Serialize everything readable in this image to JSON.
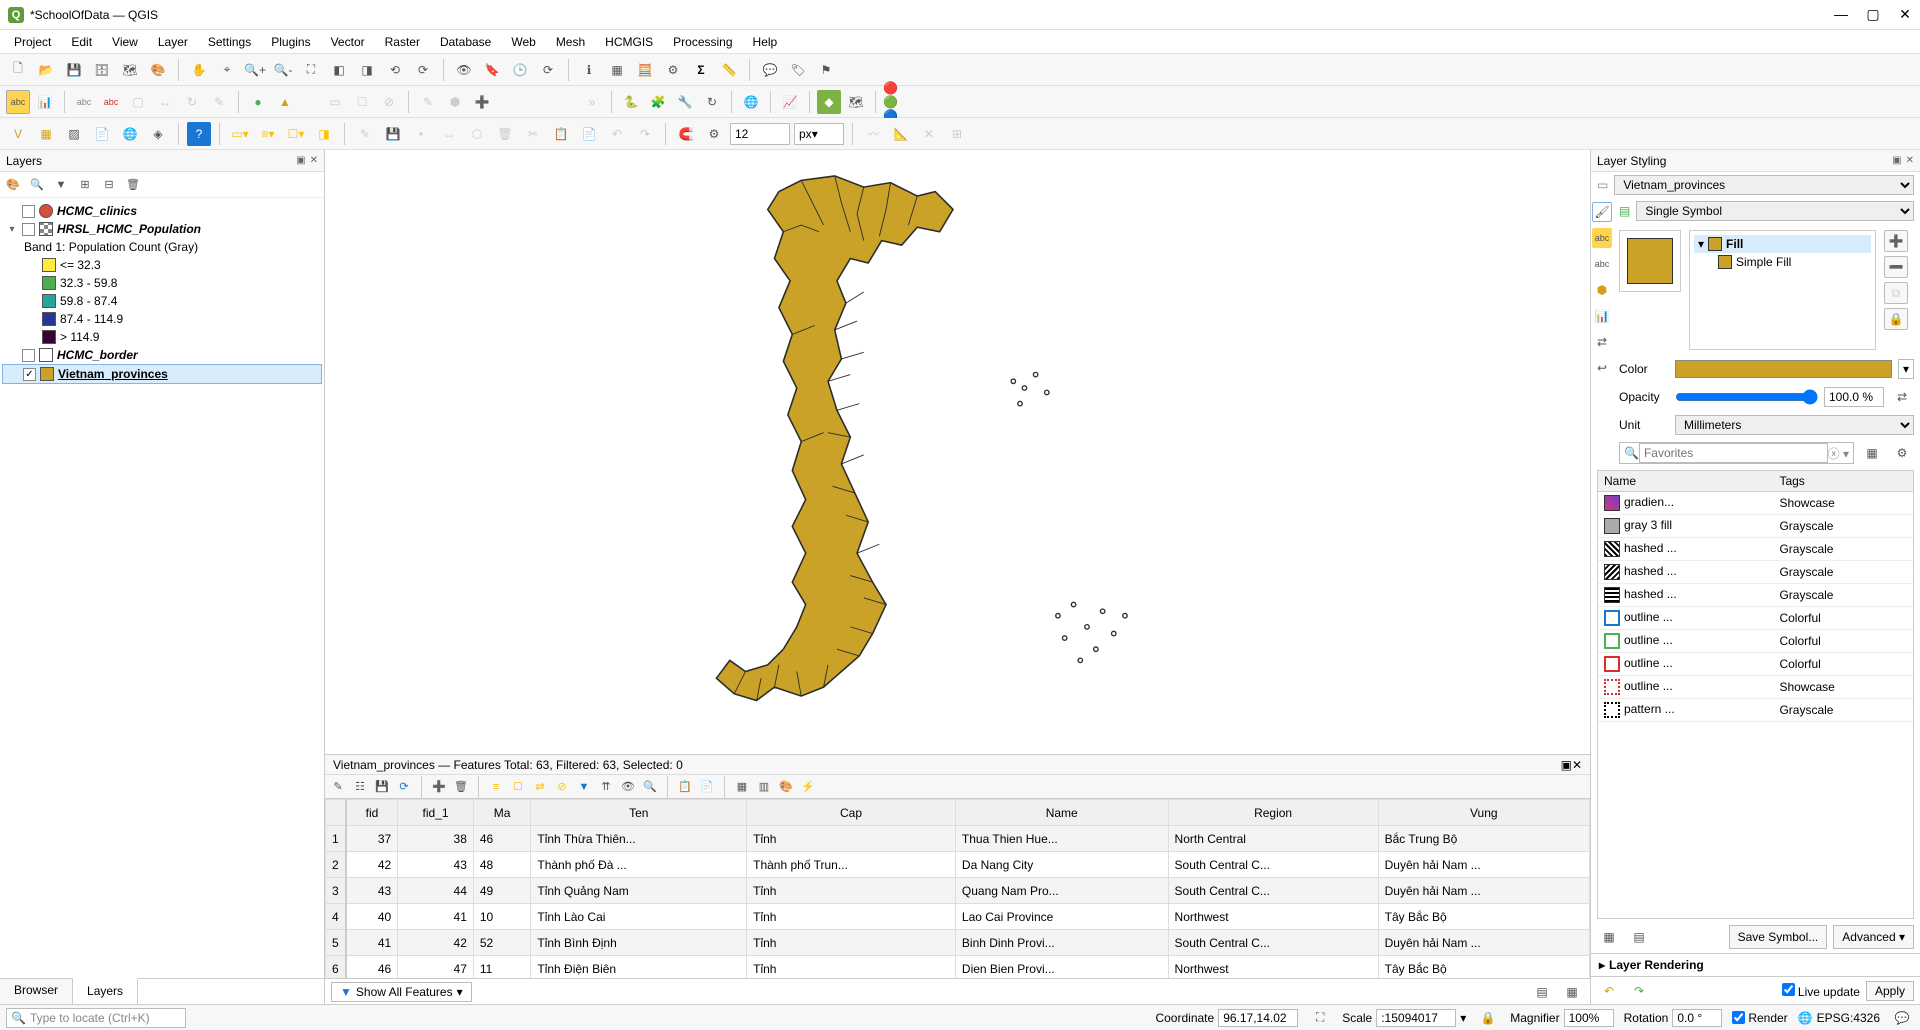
{
  "title": "*SchoolOfData — QGIS",
  "menu": [
    "Project",
    "Edit",
    "View",
    "Layer",
    "Settings",
    "Plugins",
    "Vector",
    "Raster",
    "Database",
    "Web",
    "Mesh",
    "HCMGIS",
    "Processing",
    "Help"
  ],
  "layers_panel": {
    "title": "Layers",
    "items": [
      {
        "name": "HCMC_clinics",
        "checked": false,
        "swatch": "#d94d3a",
        "shape": "circle",
        "bold": true
      },
      {
        "name": "HRSL_HCMC_Population",
        "checked": false,
        "swatch": "checker",
        "bold": true,
        "expanded": true
      },
      {
        "name": "Band 1: Population Count (Gray)",
        "indent": 1
      },
      {
        "name": "<= 32.3",
        "indent": 2,
        "swatch": "#ffeb3b"
      },
      {
        "name": "32.3 - 59.8",
        "indent": 2,
        "swatch": "#4caf50"
      },
      {
        "name": "59.8 - 87.4",
        "indent": 2,
        "swatch": "#26a69a"
      },
      {
        "name": "87.4 - 114.9",
        "indent": 2,
        "swatch": "#283593"
      },
      {
        "name": "> 114.9",
        "indent": 2,
        "swatch": "#3a0232"
      },
      {
        "name": "HCMC_border",
        "checked": false,
        "swatch": "none",
        "bold": true
      },
      {
        "name": "Vietnam_provinces",
        "checked": true,
        "swatch": "#C9A227",
        "selected": true,
        "underline": true
      }
    ],
    "tabs": [
      "Browser",
      "Layers"
    ],
    "active_tab": "Layers"
  },
  "attribute_table": {
    "header": "Vietnam_provinces — Features Total: 63, Filtered: 63, Selected: 0",
    "columns": [
      "fid",
      "fid_1",
      "Ma",
      "Ten",
      "Cap",
      "Name",
      "Region",
      "Vung"
    ],
    "rows": [
      [
        "37",
        "38",
        "46",
        "Tỉnh Thừa Thiên...",
        "Tỉnh",
        "Thua Thien Hue...",
        "North Central",
        "Bắc Trung Bộ"
      ],
      [
        "42",
        "43",
        "48",
        "Thành phố Đà ...",
        "Thành phố Trun...",
        "Da Nang City",
        "South Central C...",
        "Duyên hải Nam ..."
      ],
      [
        "43",
        "44",
        "49",
        "Tỉnh Quảng Nam",
        "Tỉnh",
        "Quang Nam Pro...",
        "South Central C...",
        "Duyên hải Nam ..."
      ],
      [
        "40",
        "41",
        "10",
        "Tỉnh Lào Cai",
        "Tỉnh",
        "Lao Cai Province",
        "Northwest",
        "Tây Bắc Bộ"
      ],
      [
        "41",
        "42",
        "52",
        "Tỉnh Bình Định",
        "Tỉnh",
        "Binh Dinh Provi...",
        "South Central C...",
        "Duyên hải Nam ..."
      ],
      [
        "46",
        "47",
        "11",
        "Tỉnh Điện Biên",
        "Tỉnh",
        "Dien Bien Provi...",
        "Northwest",
        "Tây Bắc Bộ"
      ]
    ],
    "filter_text": "Show All Features"
  },
  "layer_styling": {
    "title": "Layer Styling",
    "layer": "Vietnam_provinces",
    "symbol_mode": "Single Symbol",
    "fill_label": "Fill",
    "simple_fill_label": "Simple Fill",
    "color_label": "Color",
    "color_value": "#C9A227",
    "opacity_label": "Opacity",
    "opacity_value": "100.0 %",
    "unit_label": "Unit",
    "unit_value": "Millimeters",
    "search_placeholder": "Favorites",
    "fav_columns": [
      "Name",
      "Tags"
    ],
    "favorites": [
      {
        "sw": "linear-gradient(45deg,#d63384,#6f42c1)",
        "name": "gradien...",
        "tags": "Showcase"
      },
      {
        "sw": "#aaa",
        "name": "gray 3 fill",
        "tags": "Grayscale"
      },
      {
        "sw": "repeating-linear-gradient(45deg,#000 0 2px,#fff 2px 4px)",
        "name": "hashed ...",
        "tags": "Grayscale"
      },
      {
        "sw": "repeating-linear-gradient(-45deg,#000 0 2px,#fff 2px 4px)",
        "name": "hashed ...",
        "tags": "Grayscale"
      },
      {
        "sw": "repeating-linear-gradient(0deg,#000 0 2px,#fff 2px 4px)",
        "name": "hashed ...",
        "tags": "Grayscale"
      },
      {
        "sw": "#fff",
        "border": "#1976d2",
        "name": "outline ...",
        "tags": "Colorful"
      },
      {
        "sw": "#fff",
        "border": "#4caf50",
        "name": "outline ...",
        "tags": "Colorful"
      },
      {
        "sw": "#fff",
        "border": "#d32f2f",
        "name": "outline ...",
        "tags": "Colorful"
      },
      {
        "sw": "#fff",
        "border": "#d32f2f",
        "dotted": true,
        "name": "outline ...",
        "tags": "Showcase"
      },
      {
        "sw": "#fff",
        "border": "#000",
        "dotted": true,
        "name": "pattern ...",
        "tags": "Grayscale"
      }
    ],
    "save_symbol": "Save Symbol...",
    "advanced": "Advanced",
    "layer_rendering": "Layer Rendering",
    "live_update": "Live update",
    "apply": "Apply"
  },
  "statusbar": {
    "locate_placeholder": "Type to locate (Ctrl+K)",
    "coordinate_label": "Coordinate",
    "coordinate": "96.17,14.02",
    "scale_label": "Scale",
    "scale": ":15094017",
    "magnifier_label": "Magnifier",
    "magnifier": "100%",
    "rotation_label": "Rotation",
    "rotation": "0.0 °",
    "render": "Render",
    "crs": "EPSG:4326"
  },
  "tb_spin": {
    "val": "12",
    "unit": "px"
  }
}
